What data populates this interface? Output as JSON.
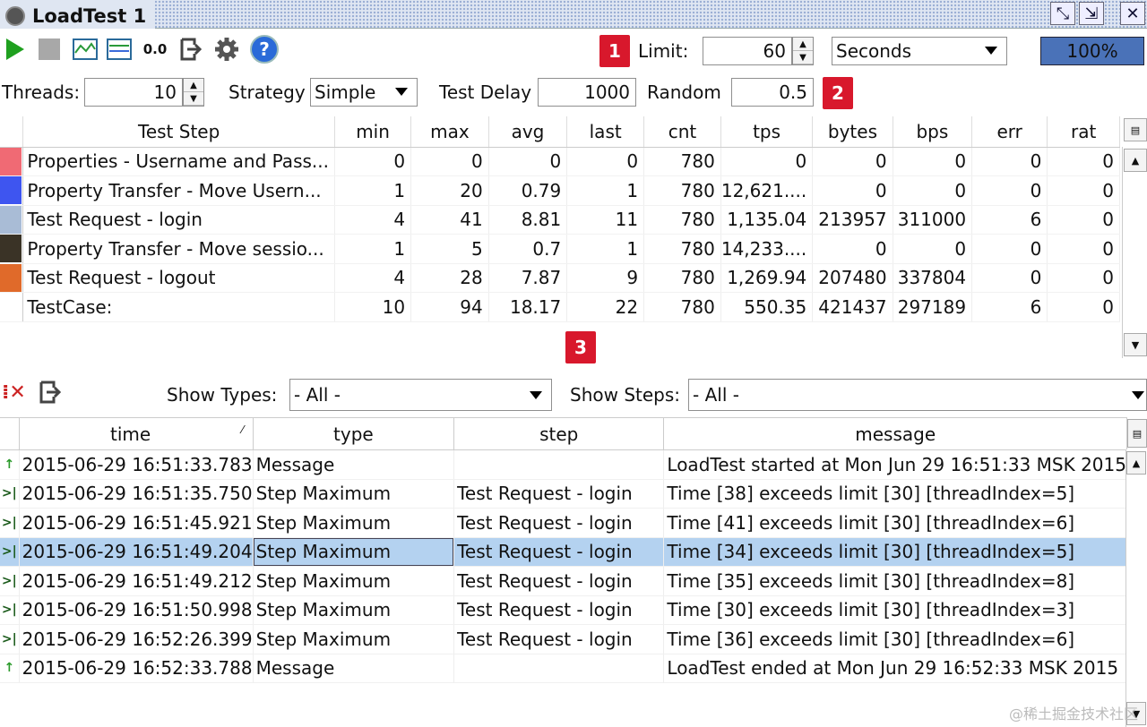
{
  "window": {
    "title": "LoadTest 1"
  },
  "toolbar": {
    "icons": [
      "run-icon",
      "stop-icon",
      "chart-icon",
      "stats-chart-icon",
      "reset-icon",
      "export-icon",
      "gear-icon",
      "help-icon"
    ],
    "reset_label": "0.0",
    "limit_label": "Limit:",
    "limit_value": "60",
    "limit_unit": "Seconds",
    "progress": "100%",
    "badge1": "1"
  },
  "settings": {
    "threads_label": "Threads:",
    "threads_value": "10",
    "strategy_label": "Strategy",
    "strategy_value": "Simple",
    "delay_label": "Test Delay",
    "delay_value": "1000",
    "random_label": "Random",
    "random_value": "0.5",
    "badge2": "2"
  },
  "stats": {
    "headers": [
      "Test Step",
      "min",
      "max",
      "avg",
      "last",
      "cnt",
      "tps",
      "bytes",
      "bps",
      "err",
      "rat"
    ],
    "rows": [
      {
        "color": "#f06a74",
        "cells": [
          "Properties - Username and Pass...",
          "0",
          "0",
          "0",
          "0",
          "780",
          "0",
          "0",
          "0",
          "0",
          "0"
        ]
      },
      {
        "color": "#3e55f0",
        "cells": [
          "Property Transfer - Move Usern...",
          "1",
          "20",
          "0.79",
          "1",
          "780",
          "12,621....",
          "0",
          "0",
          "0",
          "0"
        ]
      },
      {
        "color": "#a9bcd6",
        "cells": [
          "Test Request - login",
          "4",
          "41",
          "8.81",
          "11",
          "780",
          "1,135.04",
          "213957",
          "311000",
          "6",
          "0"
        ]
      },
      {
        "color": "#3a3326",
        "cells": [
          "Property Transfer - Move sessio...",
          "1",
          "5",
          "0.7",
          "1",
          "780",
          "14,233....",
          "0",
          "0",
          "0",
          "0"
        ]
      },
      {
        "color": "#e06a2a",
        "cells": [
          "Test Request - logout",
          "4",
          "28",
          "7.87",
          "9",
          "780",
          "1,269.94",
          "207480",
          "337804",
          "0",
          "0"
        ]
      },
      {
        "color": "#ffffff",
        "cells": [
          "TestCase:",
          "10",
          "94",
          "18.17",
          "22",
          "780",
          "550.35",
          "421437",
          "297189",
          "6",
          "0"
        ]
      }
    ],
    "badge3": "3"
  },
  "log_toolbar": {
    "show_types_label": "Show Types:",
    "show_types_value": "- All -",
    "show_steps_label": "Show Steps:",
    "show_steps_value": "- All -"
  },
  "log": {
    "headers": [
      "time",
      "type",
      "step",
      "message"
    ],
    "rows": [
      {
        "kind": "msg",
        "cells": [
          "2015-06-29 16:51:33.783",
          "Message",
          "",
          "LoadTest started at Mon Jun 29 16:51:33 MSK 2015"
        ]
      },
      {
        "kind": "max",
        "cells": [
          "2015-06-29 16:51:35.750",
          "Step Maximum",
          "Test Request - login",
          "Time [38] exceeds limit [30] [threadIndex=5]"
        ]
      },
      {
        "kind": "max",
        "cells": [
          "2015-06-29 16:51:45.921",
          "Step Maximum",
          "Test Request - login",
          "Time [41] exceeds limit [30] [threadIndex=6]"
        ]
      },
      {
        "kind": "max",
        "selected": true,
        "cells": [
          "2015-06-29 16:51:49.204",
          "Step Maximum",
          "Test Request - login",
          "Time [34] exceeds limit [30] [threadIndex=5]"
        ]
      },
      {
        "kind": "max",
        "cells": [
          "2015-06-29 16:51:49.212",
          "Step Maximum",
          "Test Request - login",
          "Time [35] exceeds limit [30] [threadIndex=8]"
        ]
      },
      {
        "kind": "max",
        "cells": [
          "2015-06-29 16:51:50.998",
          "Step Maximum",
          "Test Request - login",
          "Time [30] exceeds limit [30] [threadIndex=3]"
        ]
      },
      {
        "kind": "max",
        "cells": [
          "2015-06-29 16:52:26.399",
          "Step Maximum",
          "Test Request - login",
          "Time [36] exceeds limit [30] [threadIndex=6]"
        ]
      },
      {
        "kind": "msg",
        "cells": [
          "2015-06-29 16:52:33.788",
          "Message",
          "",
          "LoadTest ended at Mon Jun 29 16:52:33 MSK 2015"
        ]
      }
    ]
  },
  "watermark": "@稀土掘金技术社区"
}
